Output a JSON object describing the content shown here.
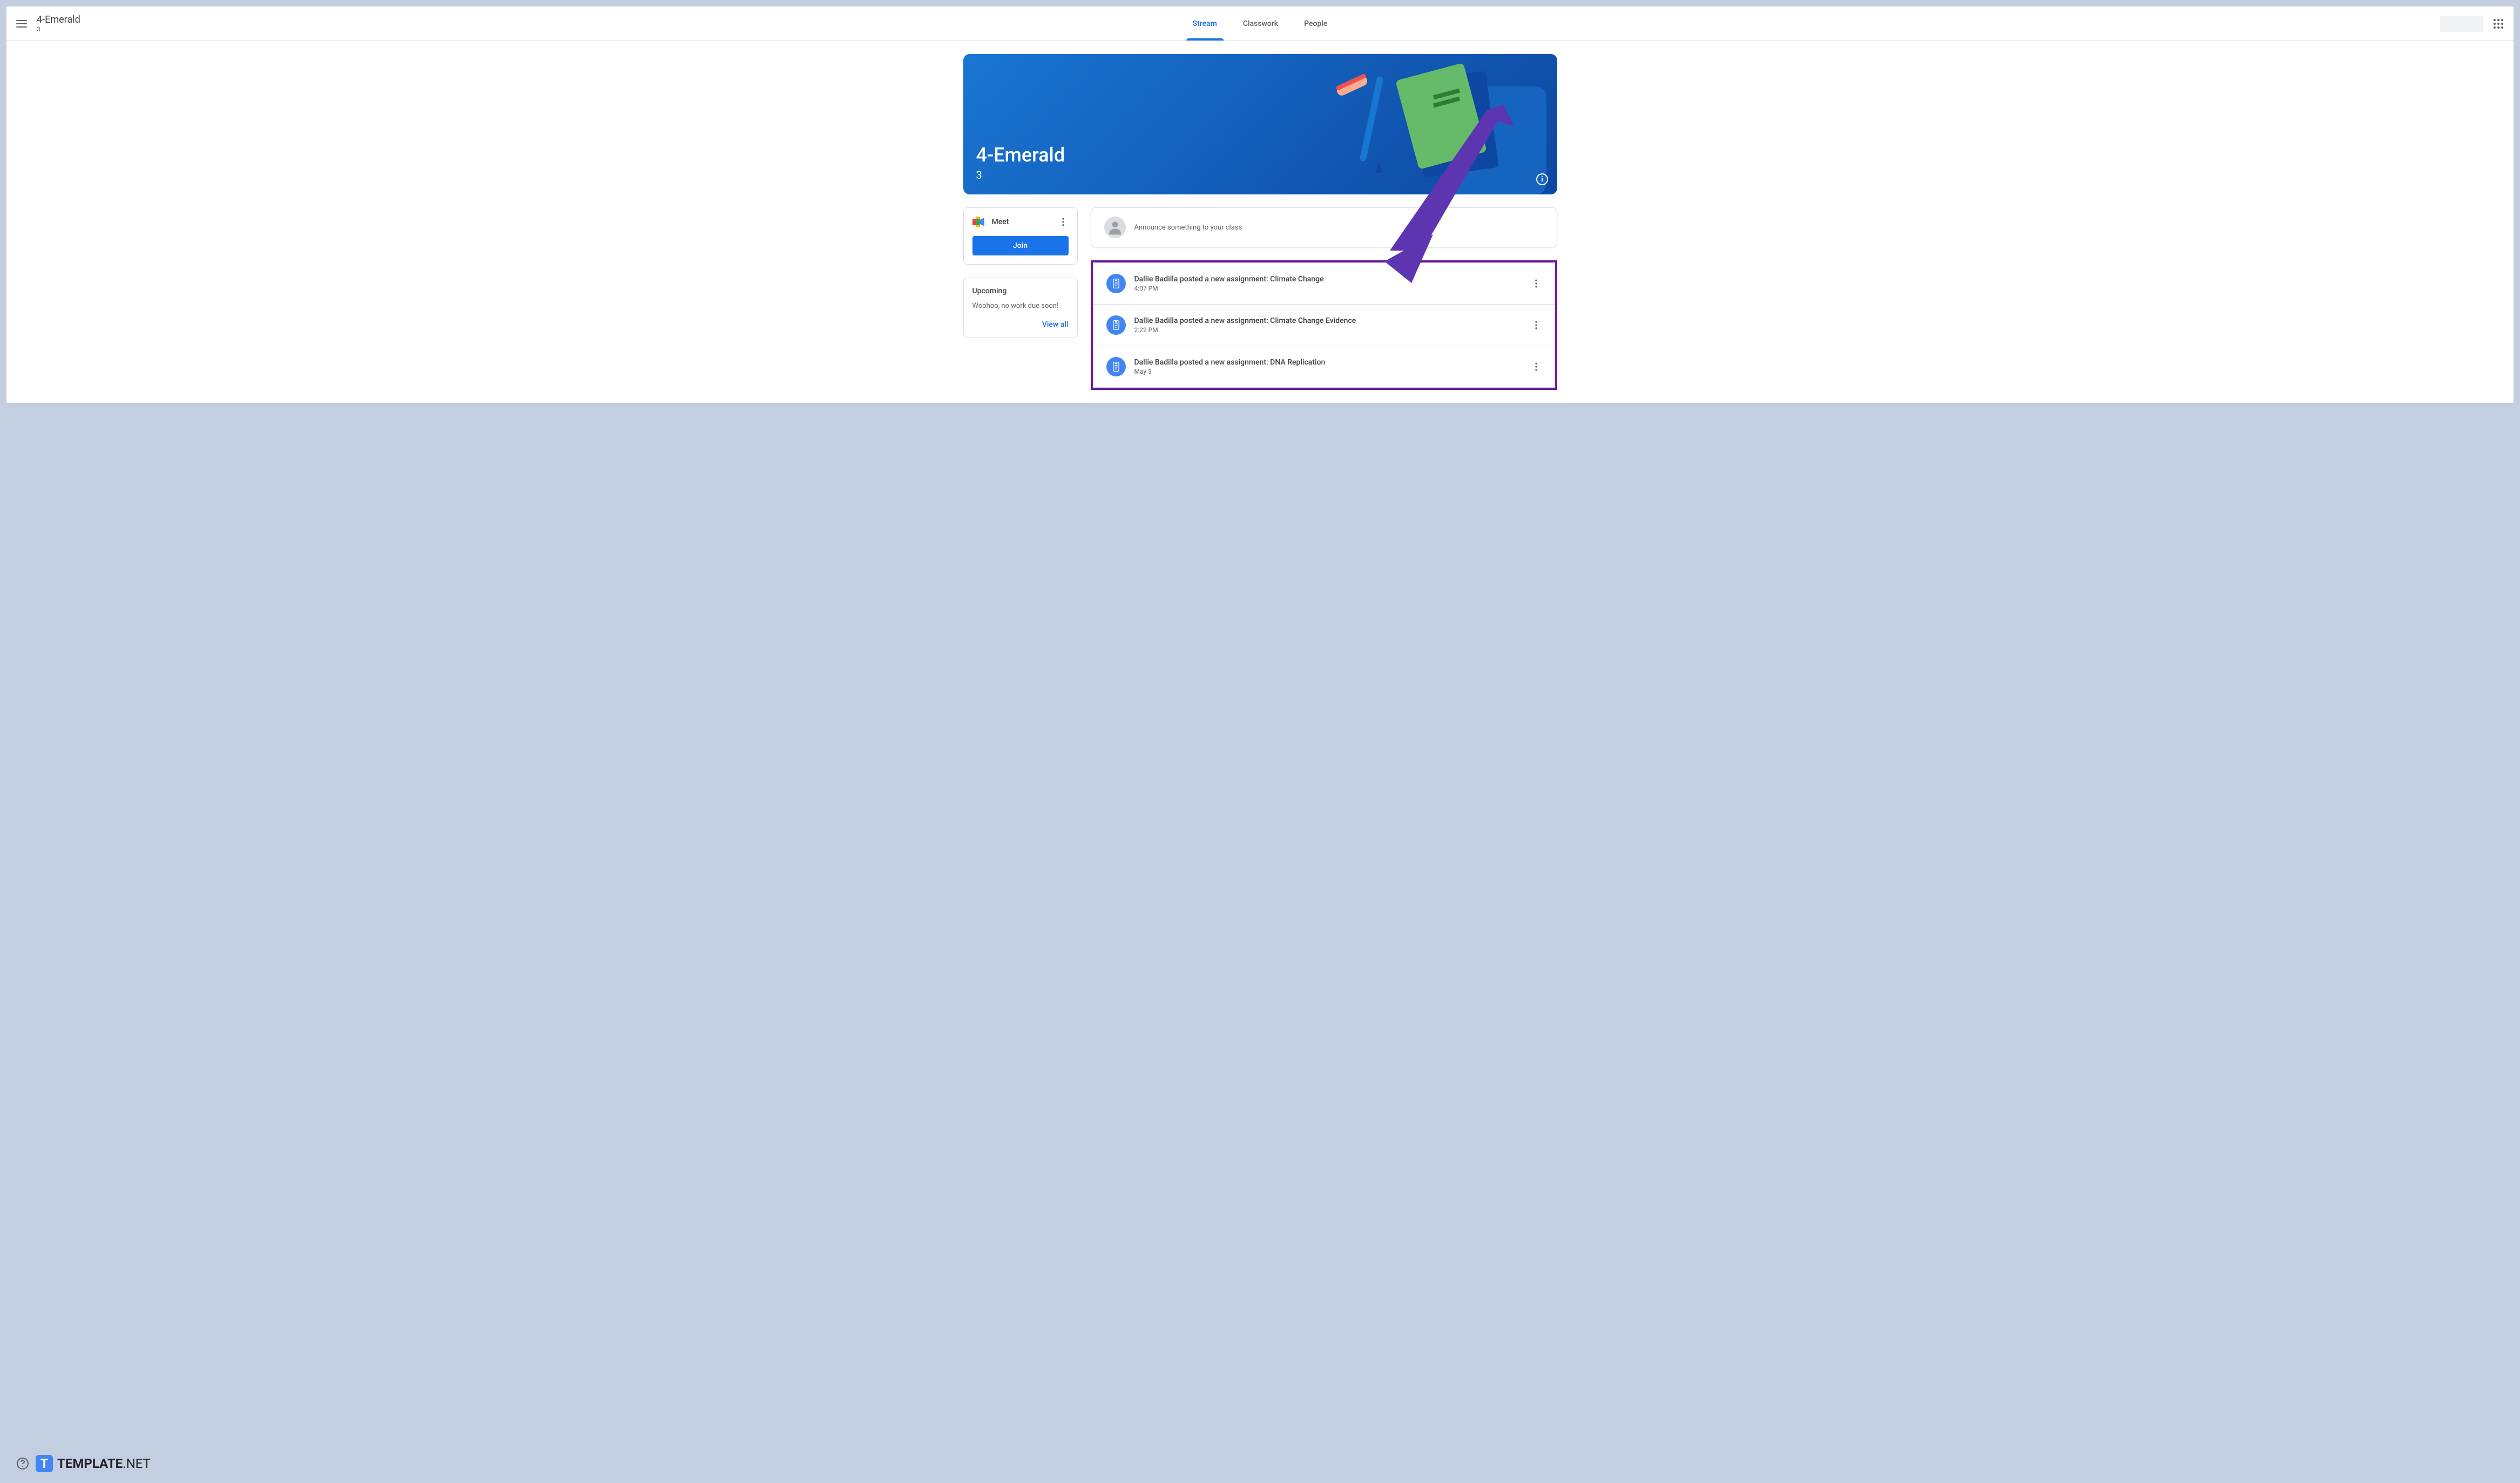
{
  "header": {
    "title": "4-Emerald",
    "subtitle": "3",
    "tabs": [
      {
        "label": "Stream",
        "active": true
      },
      {
        "label": "Classwork",
        "active": false
      },
      {
        "label": "People",
        "active": false
      }
    ]
  },
  "banner": {
    "title": "4-Emerald",
    "subtitle": "3"
  },
  "meet": {
    "label": "Meet",
    "join_label": "Join"
  },
  "upcoming": {
    "title": "Upcoming",
    "text": "Woohoo, no work due soon!",
    "view_all": "View all"
  },
  "announce": {
    "placeholder": "Announce something to your class"
  },
  "stream": [
    {
      "title": "Dallie Badilla posted a new assignment: Climate Change",
      "time": "4:07 PM"
    },
    {
      "title": "Dallie Badilla posted a new assignment: Climate Change Evidence",
      "time": "2:22 PM"
    },
    {
      "title": "Dallie Badilla posted a new assignment: DNA Replication",
      "time": "May 3"
    }
  ],
  "footer": {
    "logo_text": "TEMPLATE",
    "logo_suffix": ".NET",
    "logo_letter": "T"
  }
}
